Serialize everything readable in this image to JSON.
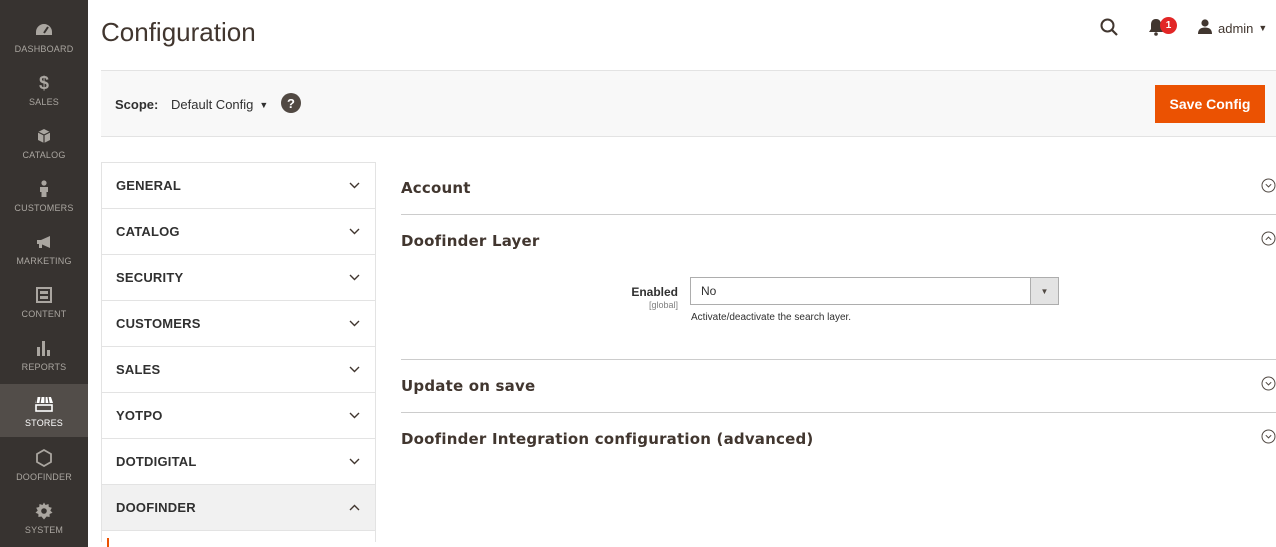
{
  "nav": {
    "items": [
      {
        "label": "DASHBOARD",
        "icon": "dashboard-icon"
      },
      {
        "label": "SALES",
        "icon": "dollar-icon"
      },
      {
        "label": "CATALOG",
        "icon": "cube-icon"
      },
      {
        "label": "CUSTOMERS",
        "icon": "person-icon"
      },
      {
        "label": "MARKETING",
        "icon": "megaphone-icon"
      },
      {
        "label": "CONTENT",
        "icon": "layout-icon"
      },
      {
        "label": "REPORTS",
        "icon": "bar-chart-icon"
      },
      {
        "label": "STORES",
        "icon": "store-icon"
      },
      {
        "label": "DOOFINDER",
        "icon": "hexagon-icon"
      },
      {
        "label": "SYSTEM",
        "icon": "gear-icon"
      }
    ],
    "active": "STORES"
  },
  "header": {
    "title": "Configuration",
    "notification_count": "1",
    "user": "admin"
  },
  "scope": {
    "label": "Scope:",
    "value": "Default Config",
    "help": "?",
    "save_label": "Save Config"
  },
  "tabs": [
    {
      "label": "GENERAL",
      "open": false
    },
    {
      "label": "CATALOG",
      "open": false
    },
    {
      "label": "SECURITY",
      "open": false
    },
    {
      "label": "CUSTOMERS",
      "open": false
    },
    {
      "label": "SALES",
      "open": false
    },
    {
      "label": "YOTPO",
      "open": false
    },
    {
      "label": "DOTDIGITAL",
      "open": false
    },
    {
      "label": "DOOFINDER",
      "open": true
    }
  ],
  "sections": {
    "account": {
      "title": "Account"
    },
    "layer": {
      "title": "Doofinder Layer",
      "enabled_label": "Enabled",
      "enabled_scope": "[global]",
      "enabled_value": "No",
      "enabled_note": "Activate/deactivate the search layer."
    },
    "update": {
      "title": "Update on save"
    },
    "advanced": {
      "title": "Doofinder Integration configuration (advanced)"
    }
  },
  "colors": {
    "nav_bg": "#373330",
    "nav_active": "#524d49",
    "accent": "#eb5202",
    "badge": "#e22626"
  }
}
